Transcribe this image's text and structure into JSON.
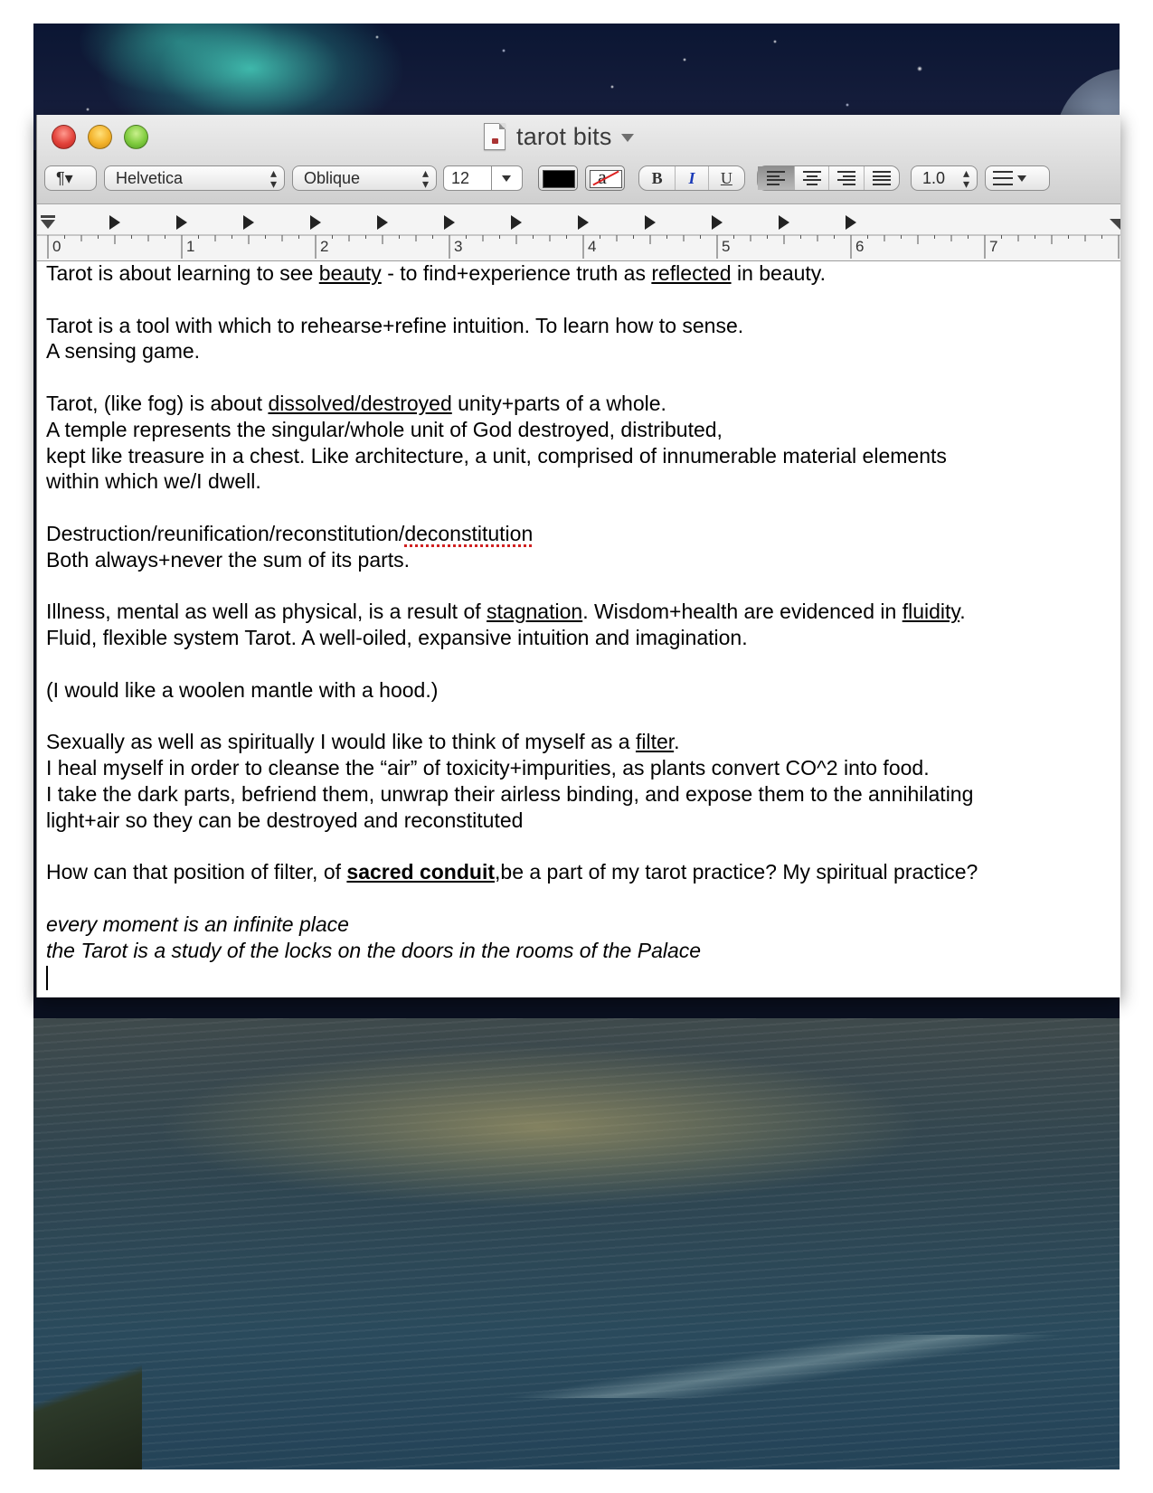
{
  "window": {
    "title": "tarot bits"
  },
  "toolbar": {
    "paragraph_label": "¶▾",
    "font_family": "Helvetica",
    "font_style": "Oblique",
    "font_size": "12",
    "text_color": "#000000",
    "highlight_glyph": "a",
    "bold_label": "B",
    "italic_label": "I",
    "underline_label": "U",
    "line_spacing": "1.0"
  },
  "ruler": {
    "numbers": [
      "0",
      "1",
      "2",
      "3",
      "4",
      "5",
      "6",
      "7"
    ]
  },
  "document": {
    "l1": {
      "a": "Tarot is about learning to see ",
      "b": "beauty",
      "c": " - to find+experience truth as ",
      "d": "reflected",
      "e": " in beauty."
    },
    "l2": "Tarot is a tool with which to rehearse+refine intuition. To learn how to sense.",
    "l3": "A sensing game.",
    "l4": {
      "a": "Tarot, (like fog) is about ",
      "b": "dissolved/destroyed",
      "c": " unity+parts of a whole."
    },
    "l5": "A temple represents the singular/whole unit of God destroyed, distributed,",
    "l6": "kept like treasure in a chest. Like architecture, a unit, comprised of innumerable material elements",
    "l7": "within which we/I dwell.",
    "l8": {
      "a": "Destruction/reunification/reconstitution/",
      "b": "deconstitution"
    },
    "l9": "Both always+never the sum of its parts.",
    "l10": {
      "a": "Illness, mental as well as physical, is a result of ",
      "b": "stagnation",
      "c": ". Wisdom+health are evidenced in ",
      "d": "fluidity",
      "e": "."
    },
    "l11": "Fluid, flexible system Tarot. A well-oiled, expansive intuition and imagination.",
    "l12": "(I would like a woolen mantle with a hood.)",
    "l13": {
      "a": "Sexually as well as spiritually I would like to think of myself as a ",
      "b": "filter",
      "c": "."
    },
    "l14": "I heal myself in order to cleanse the “air” of toxicity+impurities, as plants convert CO^2 into food.",
    "l15": "I take the dark parts, befriend them, unwrap their airless binding, and expose them to the annihilating",
    "l16": "light+air so they can be destroyed and reconstituted",
    "l17": {
      "a": "How can that position of filter, of ",
      "b": "sacred conduit",
      "c": ",be a part of my tarot practice? My spiritual practice?"
    },
    "l18": "every moment is an infinite place",
    "l19": "the Tarot is a study of the locks on the doors in the rooms of the Palace"
  }
}
